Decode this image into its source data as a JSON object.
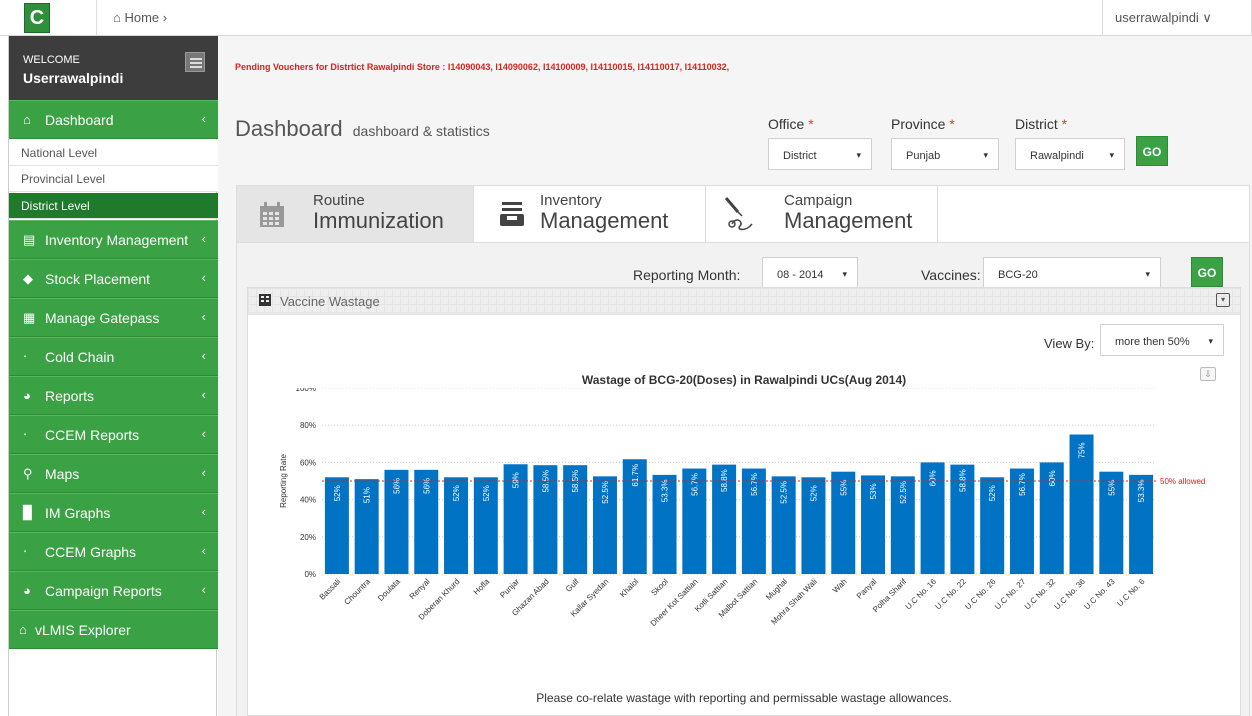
{
  "topbar": {
    "logo": "C",
    "home_label": "Home",
    "home_sep": "›",
    "user": "userrawalpindi ∨"
  },
  "sidebar": {
    "welcome": "WELCOME",
    "username": "Userrawalpindi",
    "dashboard": "Dashboard",
    "sub_items": [
      "National Level",
      "Provincial Level",
      "District Level"
    ],
    "items": [
      "Inventory Management",
      "Stock Placement",
      "Manage Gatepass",
      "Cold Chain",
      "Reports",
      "CCEM Reports",
      "Maps",
      "IM Graphs",
      "CCEM Graphs",
      "Campaign Reports",
      "vLMIS Explorer"
    ]
  },
  "main": {
    "pending": "Pending Vouchers for Distrtict Rawalpindi Store : I14090043, I14090062, I14100009, I14110015, I14110017, I14110032,",
    "title": "Dashboard",
    "subtitle": "dashboard & statistics",
    "filters": {
      "office_label": "Office",
      "office_value": "District",
      "province_label": "Province",
      "province_value": "Punjab",
      "district_label": "District",
      "district_value": "Rawalpindi",
      "required_mark": "*",
      "go": "GO"
    },
    "tabs": [
      {
        "line1": "Routine",
        "line2": "Immunization"
      },
      {
        "line1": "Inventory",
        "line2": "Management"
      },
      {
        "line1": "Campaign",
        "line2": "Management"
      }
    ],
    "reporting_month_label": "Reporting Month:",
    "reporting_month_value": "08 - 2014",
    "vaccines_label": "Vaccines:",
    "vaccines_value": "BCG-20",
    "go2": "GO",
    "widget_title": "Vaccine Wastage",
    "view_by_label": "View By:",
    "view_by_value": "more then 50%",
    "footnote": "Please co-relate wastage with reporting and permissable wastage allowances.",
    "arrow": "▾"
  },
  "colors": {
    "green": "#3aa245",
    "bar": "#0073c4",
    "red": "#d9231e"
  },
  "chart_data": {
    "type": "bar",
    "title": "Wastage of BCG-20(Doses) in Rawalpindi UCs(Aug 2014)",
    "ylabel": "Reporting Rate",
    "ylim": [
      0,
      100
    ],
    "yticks": [
      "0%",
      "20%",
      "40%",
      "60%",
      "80%",
      "100%"
    ],
    "threshold": {
      "value": 50,
      "label": "50% allowed"
    },
    "categories": [
      "Bassali",
      "Chountra",
      "Doulata",
      "Renyal",
      "Doberan Khurd",
      "Hofla",
      "Punjar",
      "Ghazan Abad",
      "Gulf",
      "Kallar Syedan",
      "Khalol",
      "Skool",
      "Dheer Kot Sattian",
      "Kotli Sattian",
      "Malbot Sattian",
      "Mughal",
      "Mohra Shah Wali",
      "Wah",
      "Panyal",
      "Polha Sharif",
      "U.C No. 16",
      "U.C No. 22",
      "U.C No. 26",
      "U.C No. 27",
      "U.C No. 32",
      "U.C No. 36",
      "U.C No. 43",
      "U.C No. 6"
    ],
    "values": [
      52,
      51,
      56,
      56,
      52,
      52,
      59,
      58.5,
      58.5,
      52.5,
      61.7,
      53.3,
      56.7,
      58.8,
      56.7,
      52.5,
      52,
      55,
      53,
      52.5,
      60,
      58.8,
      52,
      56.7,
      60,
      75,
      55,
      53.3
    ],
    "labels": [
      "52%",
      "51%",
      "56%",
      "56%",
      "52%",
      "52%",
      "59%",
      "58.5%",
      "58.5%",
      "52.5%",
      "61.7%",
      "53.3%",
      "56.7%",
      "58.8%",
      "56.7%",
      "52.5%",
      "52%",
      "55%",
      "53%",
      "52.5%",
      "60%",
      "58.8%",
      "52%",
      "56.7%",
      "60%",
      "75%",
      "55%",
      "53.3%"
    ]
  }
}
